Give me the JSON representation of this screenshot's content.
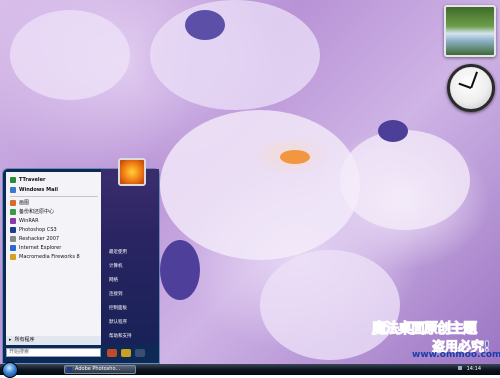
{
  "start_menu": {
    "pinned": [
      {
        "label": "TTraveler",
        "icon": "browser-icon",
        "color": "#2a8a3a"
      },
      {
        "label": "Windows Mail",
        "icon": "mail-icon",
        "color": "#3a78c8"
      }
    ],
    "recent": [
      {
        "label": "画图",
        "icon": "paint-icon",
        "color": "#d86a2a"
      },
      {
        "label": "备份和还原中心",
        "icon": "backup-icon",
        "color": "#3a9a4a"
      },
      {
        "label": "WinRAR",
        "icon": "winrar-icon",
        "color": "#8a3aa8"
      },
      {
        "label": "Photoshop CS3",
        "icon": "photoshop-icon",
        "color": "#1e3c8c"
      },
      {
        "label": "Reshacker 2007",
        "icon": "tool-icon",
        "color": "#888888"
      },
      {
        "label": "Internet Explorer",
        "icon": "ie-icon",
        "color": "#2a6ad0"
      },
      {
        "label": "Macromedia Fireworks 8",
        "icon": "fireworks-icon",
        "color": "#d8a020"
      }
    ],
    "all_programs": "所有程序",
    "search_placeholder": "开始搜索",
    "right_items": [
      "最近使用",
      "计算机",
      "网络",
      "连接到",
      "控制面板",
      "默认程序",
      "帮助和支持"
    ]
  },
  "taskbar": {
    "task_label": "Adobe Photosho...",
    "clock": "14:14"
  },
  "watermark": {
    "title": "魔法桌面原创主题",
    "slogan": "盗用必究!",
    "url": "www.ommoo.com"
  }
}
